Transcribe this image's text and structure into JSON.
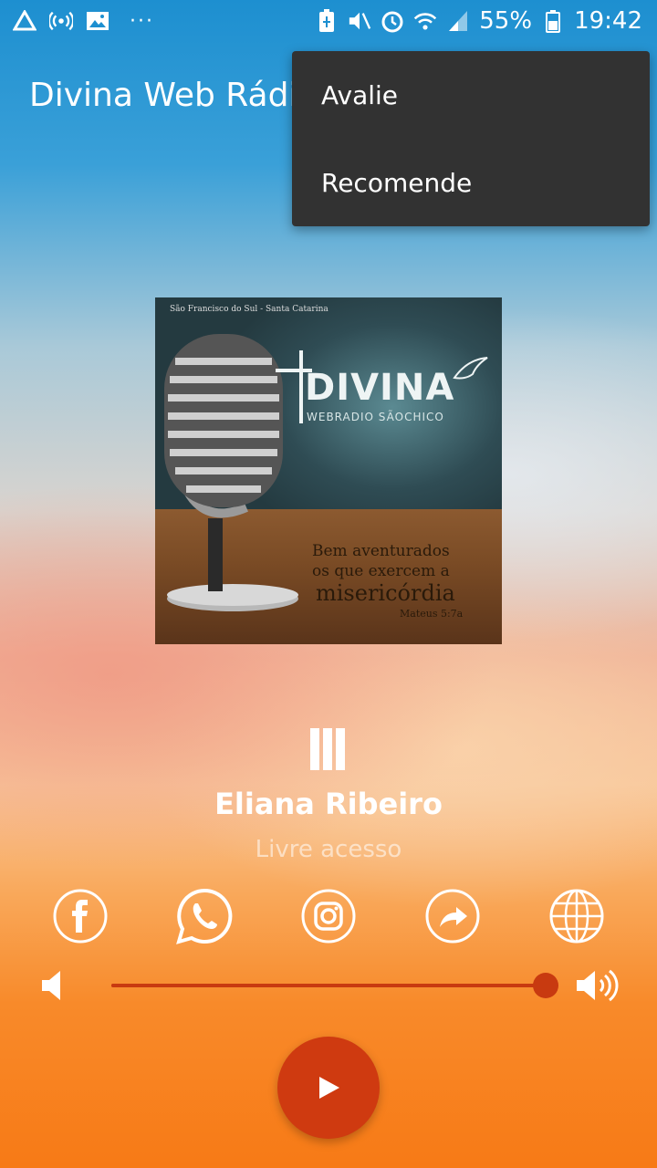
{
  "status_bar": {
    "battery": "55%",
    "time": "19:42",
    "icons": [
      "drive-icon",
      "hotspot-icon",
      "image-icon",
      "more-dots-icon",
      "battery-saver-icon",
      "mute-icon",
      "alarm-icon",
      "wifi-icon",
      "signal-icon",
      "battery-icon"
    ]
  },
  "header": {
    "title": "Divina Web Rádio"
  },
  "menu": {
    "items": [
      {
        "label": "Avalie"
      },
      {
        "label": "Recomende"
      }
    ]
  },
  "cover": {
    "location": "São Francisco do Sul - Santa Catarina",
    "brand": "DIVINA",
    "brand_sub": "WEBRADIO SÃOCHICO",
    "verse_line1": "Bem aventurados",
    "verse_line2": "os que exercem a",
    "verse_line3": "misericórdia",
    "verse_ref": "Mateus 5:7a"
  },
  "player": {
    "artist": "Eliana Ribeiro",
    "subtitle": "Livre acesso",
    "volume": 1.0
  },
  "social": [
    "facebook-icon",
    "whatsapp-icon",
    "instagram-icon",
    "share-icon",
    "globe-icon"
  ],
  "colors": {
    "accent": "#cf3a10",
    "menu_bg": "#323232"
  }
}
